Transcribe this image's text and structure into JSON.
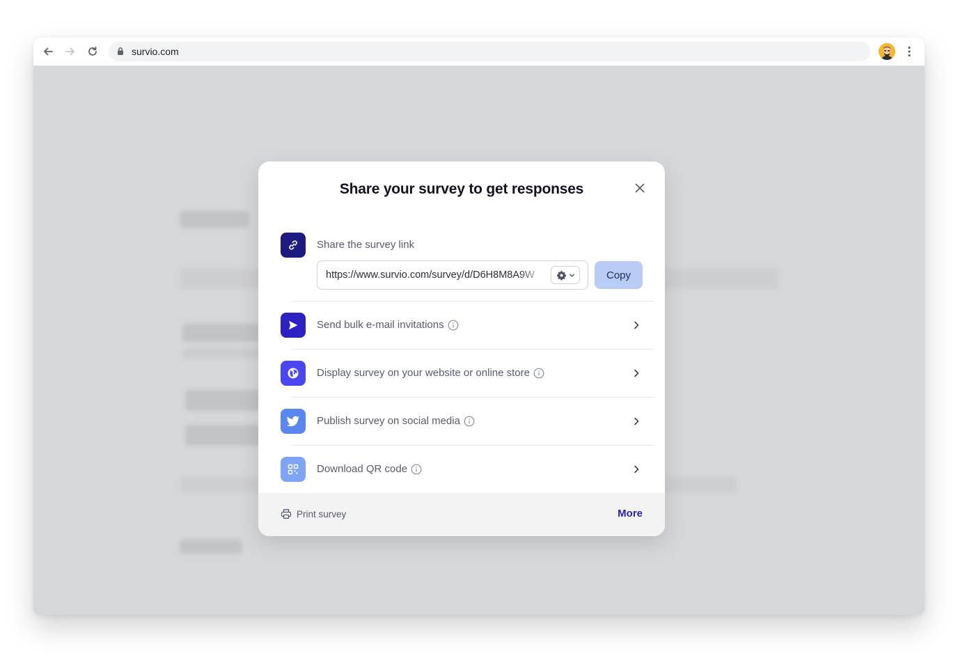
{
  "browser": {
    "url": "survio.com",
    "back_icon": "arrow-left-icon",
    "forward_icon": "arrow-right-icon",
    "reload_icon": "reload-icon",
    "lock_icon": "lock-icon",
    "menu_icon": "kebab-menu-icon"
  },
  "modal": {
    "title": "Share your survey to get responses",
    "close_icon": "close-icon",
    "share_link": {
      "label": "Share the survey link",
      "url_value": "https://www.survio.com/survey/d/D6H8M8A9W",
      "copy_label": "Copy",
      "icon": "link-icon",
      "tile_color": "#1d1b80"
    },
    "options": [
      {
        "label": "Send bulk e-mail invitations",
        "icon": "send-icon",
        "tile_color": "#2c22c4"
      },
      {
        "label": "Display survey on your website or online store",
        "icon": "globe-icon",
        "tile_color": "#4b47f0"
      },
      {
        "label": "Publish survey on social media",
        "icon": "twitter-icon",
        "tile_color": "#5a86f0"
      },
      {
        "label": "Download QR code",
        "icon": "qr-code-icon",
        "tile_color": "#7fa4f5"
      }
    ],
    "footer": {
      "print_label": "Print survey",
      "more_label": "More"
    }
  },
  "colors": {
    "accent": "#2a20b6",
    "copy_button": "#b9ccf5",
    "overlay": "#d6d7da"
  }
}
